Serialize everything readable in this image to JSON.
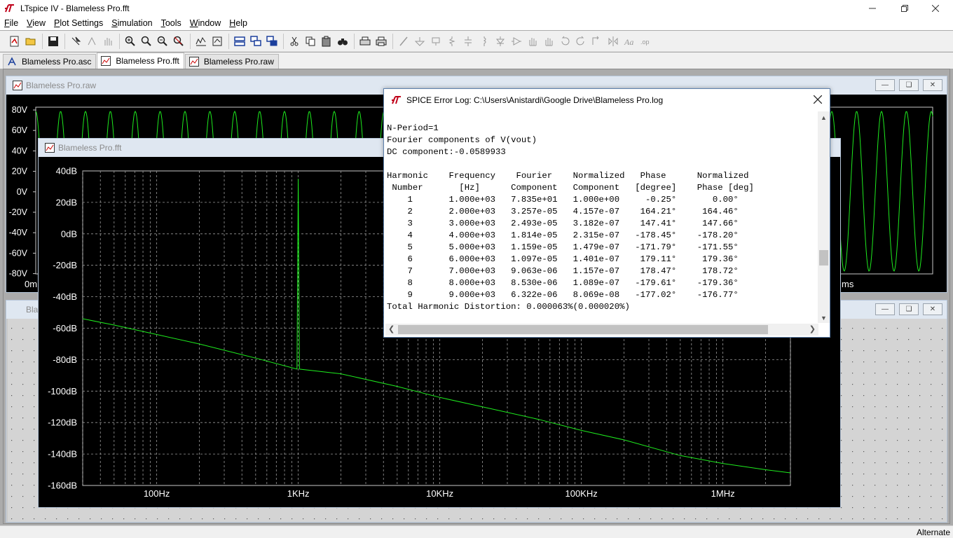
{
  "window": {
    "title": "LTspice IV - Blameless Pro.fft"
  },
  "menu": [
    {
      "key": "F",
      "rest": "ile"
    },
    {
      "key": "V",
      "rest": "iew"
    },
    {
      "key": "P",
      "rest": "lot Settings"
    },
    {
      "key": "S",
      "rest": "imulation"
    },
    {
      "key": "T",
      "rest": "ools"
    },
    {
      "key": "W",
      "rest": "indow"
    },
    {
      "key": "H",
      "rest": "elp"
    }
  ],
  "tabs": [
    {
      "label": "Blameless Pro.asc",
      "icon": "schematic-icon"
    },
    {
      "label": "Blameless Pro.fft",
      "icon": "waveform-icon"
    },
    {
      "label": "Blameless Pro.raw",
      "icon": "waveform-icon"
    }
  ],
  "raw_window": {
    "title": "Blameless Pro.raw",
    "y_ticks": [
      "80V",
      "60V",
      "40V",
      "20V",
      "0V",
      "-20V",
      "-40V",
      "-60V",
      "-80V"
    ],
    "x_left_label": "0m",
    "x_right_label": "ms"
  },
  "lower_window": {
    "title": "Bla"
  },
  "fft_window": {
    "title": "Blameless Pro.fft",
    "y_ticks": [
      "40dB",
      "20dB",
      "0dB",
      "-20dB",
      "-40dB",
      "-60dB",
      "-80dB",
      "-100dB",
      "-120dB",
      "-140dB",
      "-160dB"
    ],
    "x_ticks": [
      "100Hz",
      "1KHz",
      "10KHz",
      "100KHz",
      "1MHz"
    ]
  },
  "chart_data": [
    {
      "type": "line",
      "yscale": "linear",
      "ylim": [
        -90,
        90
      ],
      "series": [
        {
          "description": "sine waveform V(vout), amplitude ~78V, 1kHz"
        }
      ]
    },
    {
      "type": "line",
      "xscale": "log",
      "xlim": [
        30,
        3000000
      ],
      "ylim": [
        -160,
        40
      ],
      "grid": true,
      "x_ticks": [
        "100Hz",
        "1KHz",
        "10KHz",
        "100KHz",
        "1MHz"
      ],
      "y_ticks": [
        "40dB",
        "20dB",
        "0dB",
        "-20dB",
        "-40dB",
        "-60dB",
        "-80dB",
        "-100dB",
        "-120dB",
        "-140dB",
        "-160dB"
      ],
      "series": [
        {
          "x": [
            30,
            50,
            100,
            200,
            500,
            980,
            1000,
            1020,
            2000,
            5000,
            10000,
            20000,
            50000,
            100000,
            200000,
            500000,
            1000000,
            2000000,
            3000000
          ],
          "y": [
            -54,
            -58,
            -64,
            -70,
            -79,
            -86,
            35,
            -86,
            -89,
            -97,
            -104,
            -110,
            -118,
            -125,
            -131,
            -141,
            -146,
            -150,
            -152
          ]
        }
      ]
    }
  ],
  "dialog": {
    "title": "SPICE Error Log: C:\\Users\\Anistardi\\Google Drive\\Blameless Pro.log",
    "lines": [
      "N-Period=1",
      "Fourier components of V(vout)",
      "DC component:-0.0589933",
      "",
      "Harmonic    Frequency    Fourier    Normalized   Phase      Normalized",
      " Number       [Hz]      Component   Component   [degree]    Phase [deg]",
      "    1       1.000e+03   7.835e+01   1.000e+00     -0.25°       0.00°",
      "    2       2.000e+03   3.257e-05   4.157e-07    164.21°     164.46°",
      "    3       3.000e+03   2.493e-05   3.182e-07    147.41°     147.66°",
      "    4       4.000e+03   1.814e-05   2.315e-07   -178.45°    -178.20°",
      "    5       5.000e+03   1.159e-05   1.479e-07   -171.79°    -171.55°",
      "    6       6.000e+03   1.097e-05   1.401e-07    179.11°     179.36°",
      "    7       7.000e+03   9.063e-06   1.157e-07    178.47°     178.72°",
      "    8       8.000e+03   8.530e-06   1.089e-07   -179.61°    -179.36°",
      "    9       9.000e+03   6.322e-06   8.069e-08   -177.02°    -176.77°",
      "Total Harmonic Distortion: 0.000063%(0.000020%)"
    ]
  },
  "status": {
    "text": "Alternate"
  },
  "colors": {
    "trace": "#1eea1e",
    "grid": "#c8c8c8",
    "plot_bg": "#000000",
    "mdi_bg": "#ababab"
  }
}
